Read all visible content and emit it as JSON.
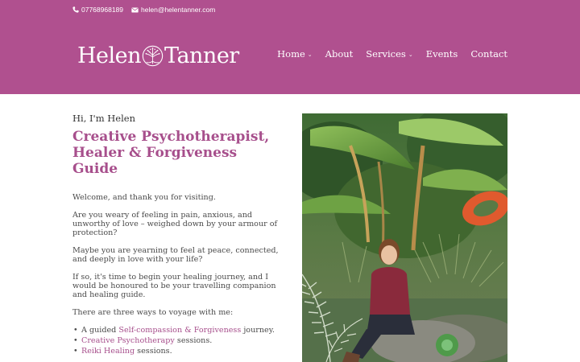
{
  "topbar": {
    "phone": "07768968189",
    "email": "helen@helentanner.com",
    "phone_icon": "phone-icon",
    "email_icon": "envelope-icon"
  },
  "logo": {
    "first": "Helen",
    "last": "Tanner",
    "icon": "tree-of-life-icon"
  },
  "nav": {
    "items": [
      {
        "label": "Home",
        "dropdown": true
      },
      {
        "label": "About",
        "dropdown": false
      },
      {
        "label": "Services",
        "dropdown": true
      },
      {
        "label": "Events",
        "dropdown": false
      },
      {
        "label": "Contact",
        "dropdown": false
      }
    ],
    "chevron": "⌄"
  },
  "content": {
    "greeting": "Hi, I'm Helen",
    "headline_line1": "Creative Psychotherapist,",
    "headline_line2": "Healer & Forgiveness Guide",
    "p1": "Welcome, and thank you for visiting.",
    "p2": "Are you weary of feeling in pain, anxious, and unworthy of love – weighed down by your armour of protection?",
    "p3": "Maybe you are yearning to feel at peace, connected, and deeply in love with your life?",
    "p4": "If so, it's time to begin your healing journey, and I would be honoured to be your travelling companion and healing guide.",
    "p5": "There are three ways to voyage with me:",
    "ways": [
      {
        "before": "A guided ",
        "link": "Self-compassion & Forgiveness",
        "after": " journey."
      },
      {
        "before": "",
        "link": "Creative Psychotherapy",
        "after": " sessions."
      },
      {
        "before": "",
        "link": "Reiki Healing",
        "after": " sessions."
      }
    ]
  },
  "colors": {
    "header_bg": "#b0508f",
    "accent": "#a74f8c",
    "text": "#4a4a4a"
  }
}
